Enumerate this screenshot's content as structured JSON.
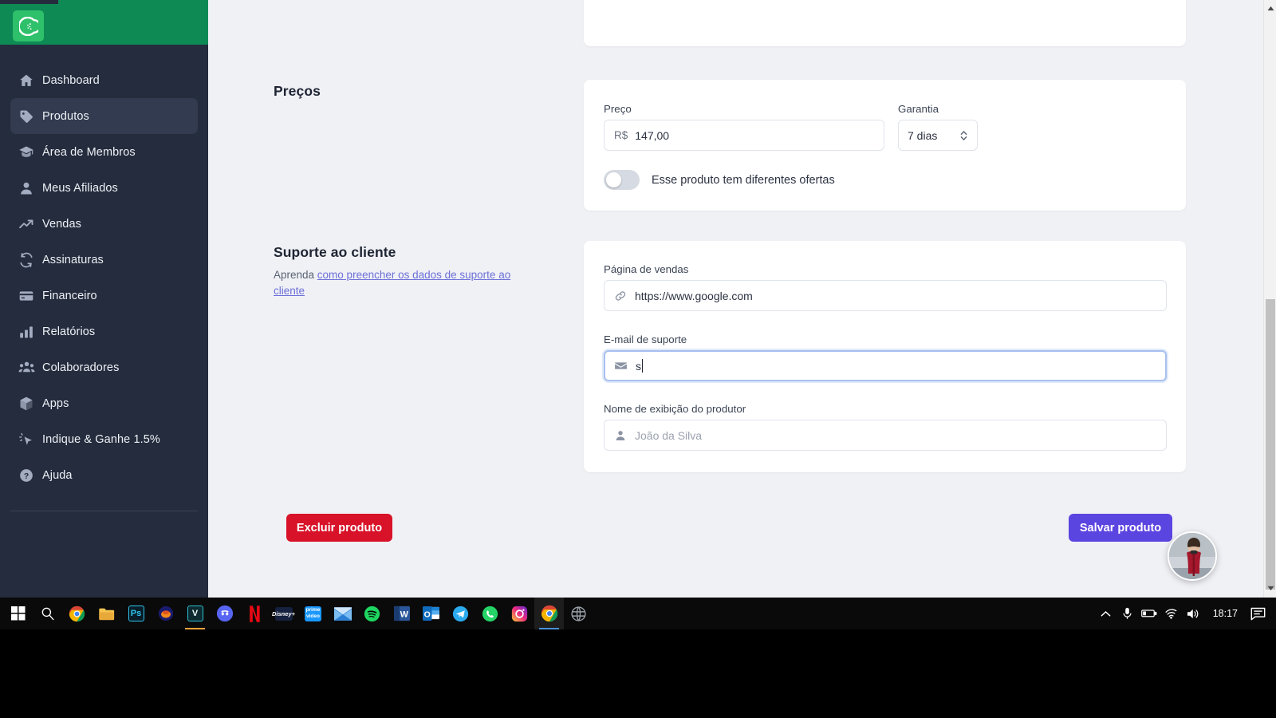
{
  "app": {
    "brand_logo_name": "kiwify-logo",
    "green": "#0e8a55",
    "sidebar_bg": "#242c3d",
    "accent_primary": "#5b45e0",
    "accent_danger": "#d81228"
  },
  "sidebar": {
    "items": [
      {
        "label": "Dashboard",
        "icon": "home-icon",
        "active": false
      },
      {
        "label": "Produtos",
        "icon": "tag-icon",
        "active": true
      },
      {
        "label": "Área de Membros",
        "icon": "graduation-cap-icon",
        "active": false
      },
      {
        "label": "Meus Afiliados",
        "icon": "user-icon",
        "active": false
      },
      {
        "label": "Vendas",
        "icon": "trending-up-icon",
        "active": false
      },
      {
        "label": "Assinaturas",
        "icon": "refresh-icon",
        "active": false
      },
      {
        "label": "Financeiro",
        "icon": "credit-card-icon",
        "active": false
      },
      {
        "label": "Relatórios",
        "icon": "bar-chart-icon",
        "active": false
      },
      {
        "label": "Colaboradores",
        "icon": "users-icon",
        "active": false
      },
      {
        "label": "Apps",
        "icon": "cube-icon",
        "active": false
      },
      {
        "label": "Indique & Ganhe 1.5%",
        "icon": "cursor-click-icon",
        "active": false
      },
      {
        "label": "Ajuda",
        "icon": "question-circle-icon",
        "active": false
      }
    ]
  },
  "pricing": {
    "section_title": "Preços",
    "price_label": "Preço",
    "price_currency": "R$",
    "price_value": "147,00",
    "warranty_label": "Garantia",
    "warranty_value": "7 dias",
    "offers_toggle_label": "Esse produto tem diferentes ofertas",
    "offers_toggle_on": false
  },
  "support": {
    "section_title": "Suporte ao cliente",
    "help_prefix": "Aprenda ",
    "help_link": "como preencher os dados de suporte ao cliente",
    "sales_page_label": "Página de vendas",
    "sales_page_value": "https://www.google.com",
    "sales_page_icon": "link-icon",
    "email_label": "E-mail de suporte",
    "email_value": "s",
    "email_icon": "envelope-icon",
    "producer_name_label": "Nome de exibição do produtor",
    "producer_name_placeholder": "João da Silva",
    "producer_name_icon": "person-icon"
  },
  "actions": {
    "delete_label": "Excluir produto",
    "save_label": "Salvar produto"
  },
  "taskbar": {
    "apps": [
      {
        "name": "start-button",
        "glyph": "win",
        "color": "#ffffff"
      },
      {
        "name": "search-taskbar",
        "glyph": "search",
        "color": "#ffffff"
      },
      {
        "name": "chrome-taskbar",
        "glyph": "chrome",
        "color": "#e8453c"
      },
      {
        "name": "file-explorer",
        "glyph": "folder",
        "color": "#f7c451"
      },
      {
        "name": "photoshop",
        "glyph": "Ps",
        "color": "#31c5f0"
      },
      {
        "name": "oracle-app",
        "glyph": "blob",
        "color": "#f28b1b"
      },
      {
        "name": "vegas-pro",
        "glyph": "V",
        "color": "#2ec1d3"
      },
      {
        "name": "discord",
        "glyph": "discord",
        "color": "#5865f2"
      },
      {
        "name": "netflix",
        "glyph": "N",
        "color": "#e50914"
      },
      {
        "name": "disney-plus",
        "glyph": "D+",
        "color": "#1f3c80"
      },
      {
        "name": "prime-video",
        "glyph": "pv",
        "color": "#1a98ff"
      },
      {
        "name": "mail",
        "glyph": "mail",
        "color": "#2c7fd4"
      },
      {
        "name": "spotify",
        "glyph": "spotify",
        "color": "#1ed760"
      },
      {
        "name": "word",
        "glyph": "W",
        "color": "#2b579a"
      },
      {
        "name": "outlook",
        "glyph": "O",
        "color": "#0f6cbd"
      },
      {
        "name": "telegram",
        "glyph": "tg",
        "color": "#2aabee"
      },
      {
        "name": "whatsapp",
        "glyph": "wa",
        "color": "#25d366"
      },
      {
        "name": "instagram",
        "glyph": "ig",
        "color": "#d62976"
      },
      {
        "name": "chrome-active",
        "glyph": "chrome",
        "color": "#e8453c"
      },
      {
        "name": "browser-other",
        "glyph": "globe",
        "color": "#8a8f98"
      }
    ],
    "tray": {
      "show_hidden_icons": "chevron-up-icon",
      "microphone": "microphone-icon",
      "battery": "battery-icon",
      "wifi": "wifi-icon",
      "volume": "volume-icon",
      "clock": "18:17",
      "notifications": "notification-icon"
    }
  },
  "scrollbar": {
    "up_arrow": "scroll-up-arrow",
    "down_arrow": "scroll-down-arrow",
    "thumb": "scroll-thumb"
  }
}
